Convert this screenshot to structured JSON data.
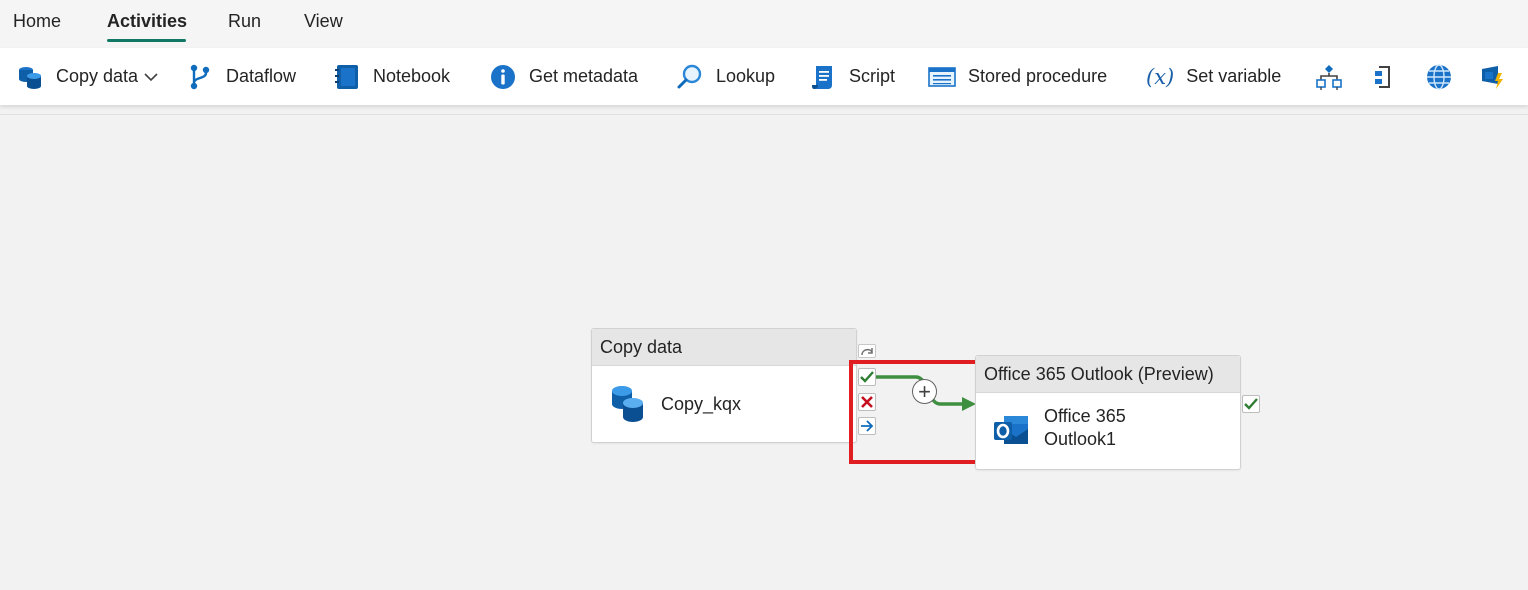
{
  "tabs": [
    {
      "label": "Home",
      "active": false
    },
    {
      "label": "Activities",
      "active": true
    },
    {
      "label": "Run",
      "active": false
    },
    {
      "label": "View",
      "active": false
    }
  ],
  "toolbar": {
    "copy_data": "Copy data",
    "dataflow": "Dataflow",
    "notebook": "Notebook",
    "get_metadata": "Get metadata",
    "lookup": "Lookup",
    "script": "Script",
    "stored_procedure": "Stored procedure",
    "set_variable": "Set variable",
    "icons": [
      "condition-icon",
      "foreach-icon",
      "web-icon",
      "teams-notify-icon"
    ]
  },
  "canvas": {
    "copy_node": {
      "header": "Copy data",
      "name": "Copy_kqx"
    },
    "outlook_node": {
      "header": "Office 365 Outlook (Preview)",
      "name_line1": "Office 365",
      "name_line2": "Outlook1"
    },
    "add_symbol": "+"
  },
  "colors": {
    "accent": "#117865",
    "success": "#2e7d32",
    "failure": "#c50f1f",
    "completion": "#0f6cbd",
    "highlight": "#e01e22"
  }
}
